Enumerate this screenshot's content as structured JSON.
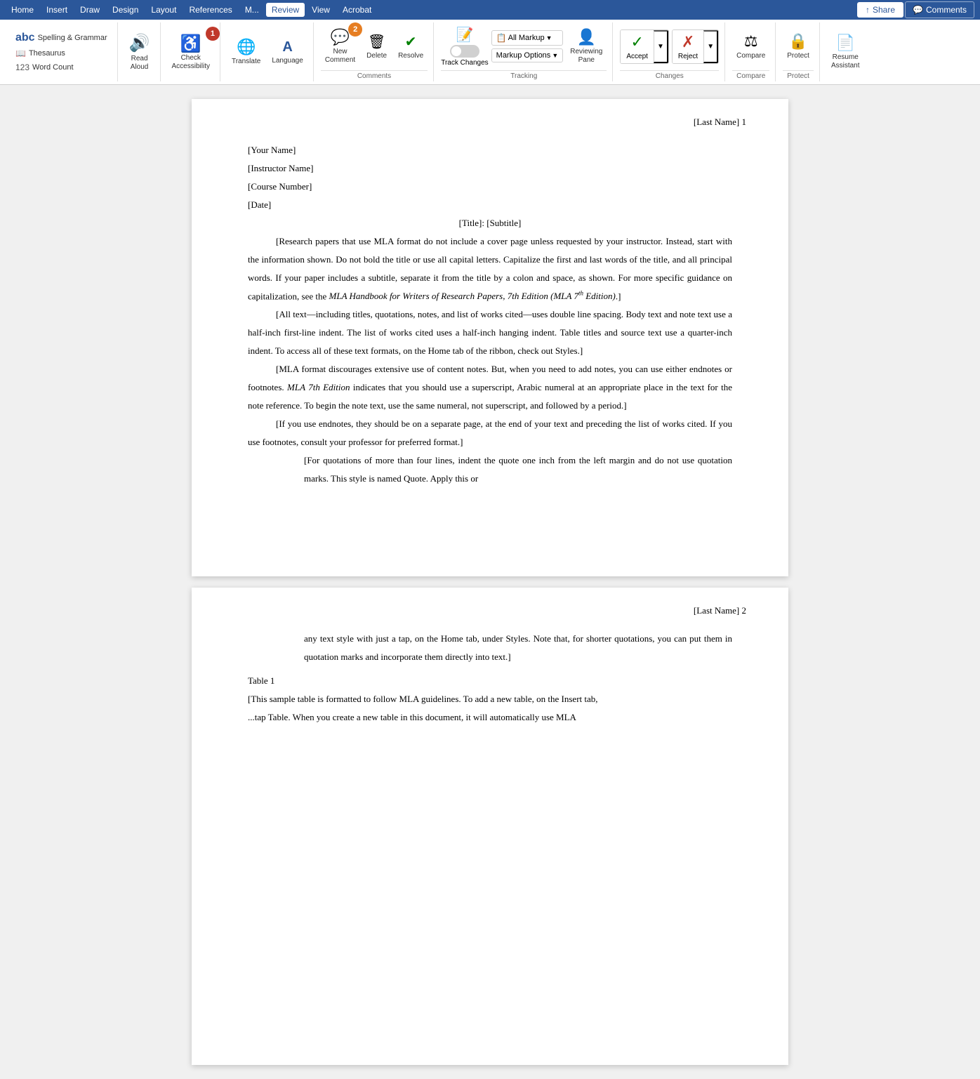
{
  "menubar": {
    "items": [
      {
        "id": "home",
        "label": "Home"
      },
      {
        "id": "insert",
        "label": "Insert"
      },
      {
        "id": "draw",
        "label": "Draw"
      },
      {
        "id": "design",
        "label": "Design"
      },
      {
        "id": "layout",
        "label": "Layout"
      },
      {
        "id": "references",
        "label": "References"
      },
      {
        "id": "mailings",
        "label": "M..."
      },
      {
        "id": "review",
        "label": "Review",
        "active": true
      },
      {
        "id": "view",
        "label": "View"
      },
      {
        "id": "acrobat",
        "label": "Acrobat"
      }
    ],
    "share_label": "Share",
    "comments_label": "Comments"
  },
  "ribbon": {
    "groups": {
      "proofing": {
        "label": "",
        "items": [
          {
            "id": "spelling",
            "label": "Spelling & Grammar"
          },
          {
            "id": "thesaurus",
            "label": "Thesaurus"
          },
          {
            "id": "word_count",
            "label": "Word Count"
          }
        ]
      },
      "speech": {
        "label": "",
        "read_aloud_label": "Read\nAloud"
      },
      "accessibility": {
        "label": "",
        "check_label": "Check\nAccessibility"
      },
      "language": {
        "label": "",
        "translate_label": "Translate",
        "language_label": "Language"
      },
      "comments": {
        "label": "Comments",
        "new_label": "New\nComment",
        "delete_label": "Delete",
        "resolve_label": "Resolve"
      },
      "tracking": {
        "label": "Tracking",
        "track_changes_label": "Track\nChanges",
        "all_markup_label": "All Markup",
        "markup_options_label": "Markup Options",
        "reviewing_label": "Reviewing\nPane"
      },
      "changes": {
        "label": "Changes",
        "accept_label": "Accept",
        "reject_label": "Reject"
      },
      "compare": {
        "label": "Compare",
        "compare_label": "Compare"
      },
      "protect": {
        "label": "Protect",
        "protect_label": "Protect"
      },
      "resume": {
        "label": "Resume\nAssistant",
        "resume_label": "Resume\nAssistant"
      }
    }
  },
  "document": {
    "pages": [
      {
        "page_num": 1,
        "header": "[Last Name] 1",
        "lines": [
          {
            "type": "field",
            "text": "[Your Name]"
          },
          {
            "type": "field",
            "text": "[Instructor Name]"
          },
          {
            "type": "field",
            "text": "[Course Number]"
          },
          {
            "type": "field",
            "text": "[Date]"
          },
          {
            "type": "title",
            "text": "[Title]: [Subtitle]"
          },
          {
            "type": "paragraph",
            "text": "[Research papers that use MLA format do not include a cover page unless requested by your instructor. Instead, start with the information shown. Do not bold the title or use all capital letters. Capitalize the first and last words of the title, and all principal words. If your paper includes a subtitle, separate it from the title by a colon and space, as shown. For more specific guidance on capitalization, see the ",
            "italic_part": "MLA Handbook for Writers of Research Papers, 7th Edition (MLA 7",
            "superscript": "th",
            "italic_end": " Edition)",
            "end_text": ".]"
          },
          {
            "type": "paragraph",
            "text": "[All text—including titles, quotations, notes, and list of works cited—uses double line spacing. Body text and note text use a half-inch first-line indent. The list of works cited uses a half-inch hanging indent. Table titles and source text use a quarter-inch indent. To access all of these text formats, on the Home tab of the ribbon, check out Styles.]"
          },
          {
            "type": "paragraph",
            "text": "[MLA format discourages extensive use of content notes. But, when you need to add notes, you can use either endnotes or footnotes. ",
            "italic_part": "MLA 7th Edition",
            "end_text": " indicates that you should use a superscript, Arabic numeral at an appropriate place in the text for the note reference. To begin the note text, use the same numeral, not superscript, and followed by a period.]"
          },
          {
            "type": "paragraph",
            "text": "[If you use endnotes, they should be on a separate page, at the end of your text and preceding the list of works cited. If you use footnotes, consult your professor for preferred format.]"
          },
          {
            "type": "block_quote",
            "text": "[For quotations of more than four lines, indent the quote one inch from the left margin and do not use quotation marks. This style is named Quote. Apply this or"
          }
        ]
      },
      {
        "page_num": 2,
        "header": "[Last Name] 2",
        "lines": [
          {
            "type": "block_quote_cont",
            "text": "any text style with just a tap, on the Home tab, under Styles. Note that, for shorter quotations, you can put them in quotation marks and incorporate them directly into text.]"
          },
          {
            "type": "label",
            "text": "Table 1"
          },
          {
            "type": "field",
            "text": "[This sample table is formatted to follow MLA guidelines. To add a new table, on the Insert tab,"
          },
          {
            "type": "field",
            "text": "...tap Table. When you create a new table in this document, it will automatically use MLA"
          }
        ]
      }
    ]
  },
  "badges": {
    "one": {
      "label": "1",
      "color": "#c0392b"
    },
    "two": {
      "label": "2",
      "color": "#e67e22"
    }
  },
  "colors": {
    "ribbon_bg": "#ffffff",
    "menu_bg": "#2b579a",
    "active_tab": "#ffffff",
    "doc_bg": "#f0f0f0"
  }
}
